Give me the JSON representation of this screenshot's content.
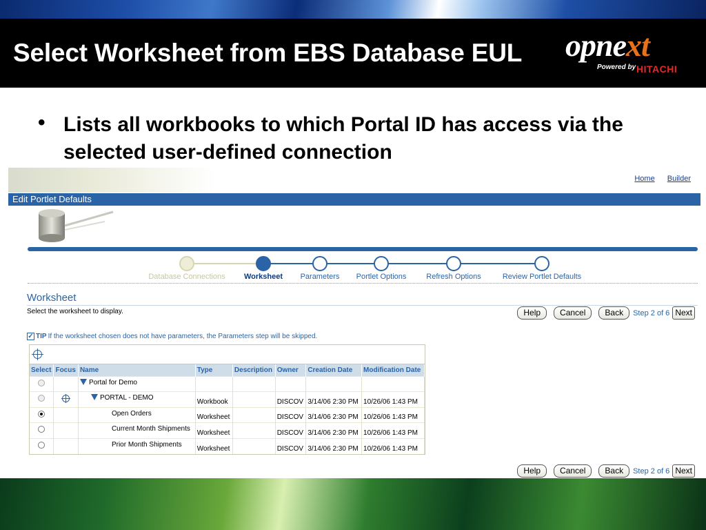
{
  "slide": {
    "title": "Select Worksheet from EBS Database EUL",
    "bullet": "Lists all workbooks to which Portal ID has access via the selected user-defined connection",
    "logo": {
      "word": "opnext",
      "powered": "Powered by",
      "brand": "HITACHI"
    }
  },
  "app": {
    "links": [
      "Home",
      "Builder"
    ],
    "portlet_title": "Edit Portlet Defaults",
    "train": [
      {
        "label": "Database Connections",
        "state": "done"
      },
      {
        "label": "Worksheet",
        "state": "current"
      },
      {
        "label": "Parameters",
        "state": "todo"
      },
      {
        "label": "Portlet Options",
        "state": "todo"
      },
      {
        "label": "Refresh Options",
        "state": "todo"
      },
      {
        "label": "Review Portlet Defaults",
        "state": "todo"
      }
    ],
    "section_title": "Worksheet",
    "instruction": "Select the worksheet to display.",
    "buttons": {
      "help": "Help",
      "cancel": "Cancel",
      "back": "Back",
      "next": "Next",
      "step": "Step 2 of 6"
    },
    "tip_label": "TIP",
    "tip_text": "If the worksheet chosen does not have parameters, the Parameters step will be skipped.",
    "table": {
      "columns": [
        "Select",
        "Focus",
        "Name",
        "Type",
        "Description",
        "Owner",
        "Creation Date",
        "Modification Date"
      ],
      "rows": [
        {
          "select": "dim",
          "focus": false,
          "indent": 0,
          "expand": true,
          "name": "Portal for Demo",
          "type": "",
          "description": "",
          "owner": "",
          "created": "",
          "modified": ""
        },
        {
          "select": "dim",
          "focus": true,
          "indent": 1,
          "expand": true,
          "name": "PORTAL - DEMO",
          "type": "Workbook",
          "description": "",
          "owner": "DISCOV",
          "created": "3/14/06 2:30 PM",
          "modified": "10/26/06 1:43 PM"
        },
        {
          "select": "on",
          "focus": false,
          "indent": 2,
          "expand": false,
          "name": "Open Orders",
          "type": "Worksheet",
          "description": "",
          "owner": "DISCOV",
          "created": "3/14/06 2:30 PM",
          "modified": "10/26/06 1:43 PM"
        },
        {
          "select": "off",
          "focus": false,
          "indent": 2,
          "expand": false,
          "name": "Current Month Shipments",
          "type": "Worksheet",
          "description": "",
          "owner": "DISCOV",
          "created": "3/14/06 2:30 PM",
          "modified": "10/26/06 1:43 PM"
        },
        {
          "select": "off",
          "focus": false,
          "indent": 2,
          "expand": false,
          "name": "Prior Month Shipments",
          "type": "Worksheet",
          "description": "",
          "owner": "DISCOV",
          "created": "3/14/06 2:30 PM",
          "modified": "10/26/06 1:43 PM"
        }
      ]
    }
  },
  "colors": {
    "accent": "#2b64a6",
    "title_bg": "#000000",
    "logo_orange": "#e8711c",
    "hitachi_red": "#e32a2a"
  }
}
